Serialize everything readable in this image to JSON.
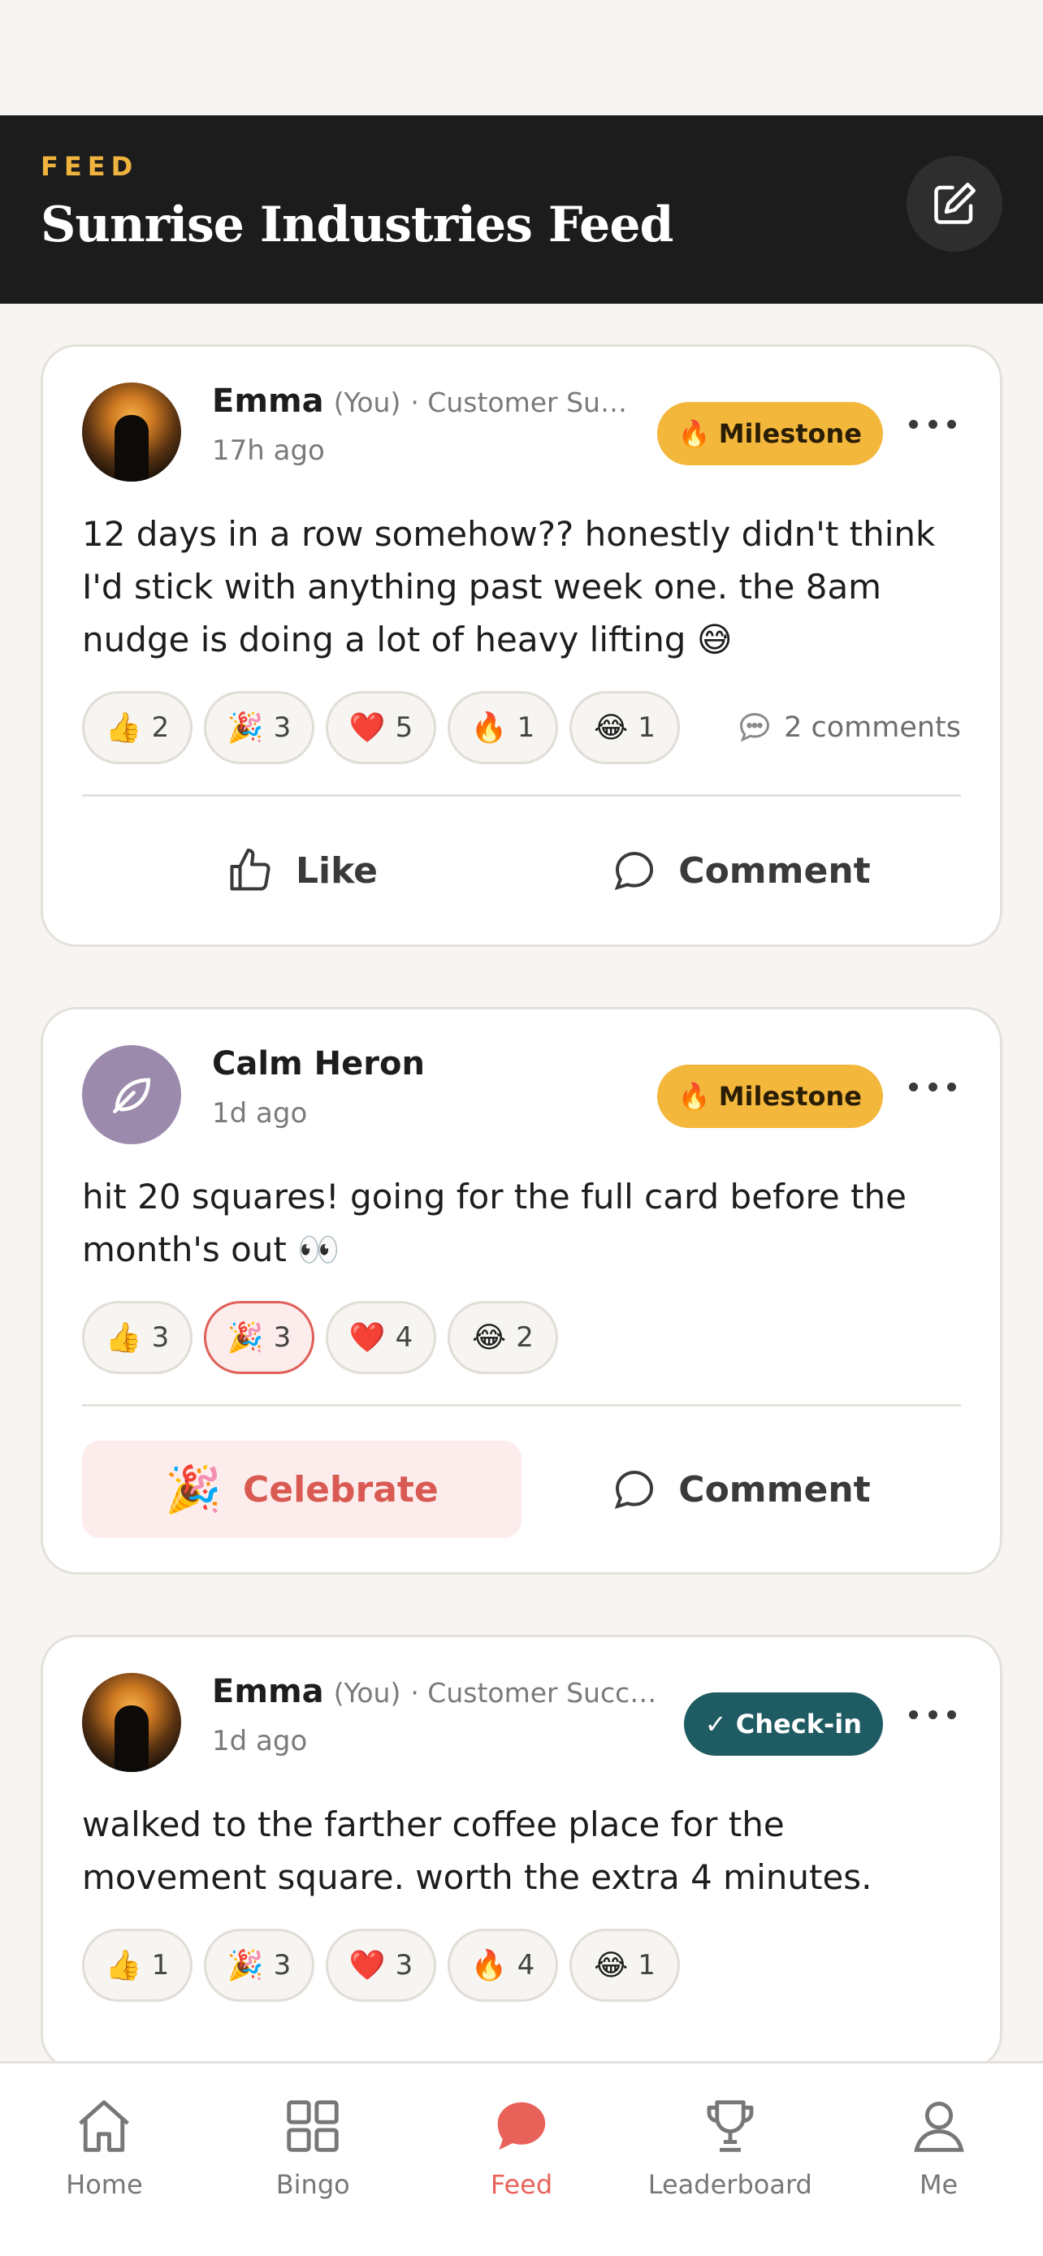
{
  "header": {
    "eyebrow": "FEED",
    "title": "Sunrise Industries Feed",
    "compose_icon": "compose-icon"
  },
  "posts": [
    {
      "author": "Emma",
      "you_tag": "(You)",
      "dept": "· Customer Succ...",
      "time": "17h ago",
      "badge": {
        "emoji": "🔥",
        "label": "Milestone",
        "type": "milestone"
      },
      "text": "12 days in a row somehow?? honestly didn't think I'd stick with anything past week one. the 8am nudge is doing a lot of heavy lifting 😅",
      "reactions": [
        {
          "emoji": "👍",
          "count": "2"
        },
        {
          "emoji": "🎉",
          "count": "3"
        },
        {
          "emoji": "❤️",
          "count": "5"
        },
        {
          "emoji": "🔥",
          "count": "1"
        },
        {
          "emoji": "😂",
          "count": "1"
        }
      ],
      "comments": "2 comments",
      "actions": {
        "primary": "Like",
        "secondary": "Comment"
      }
    },
    {
      "author": "Calm Heron",
      "time": "1d ago",
      "badge": {
        "emoji": "🔥",
        "label": "Milestone",
        "type": "milestone"
      },
      "text": "hit 20 squares! going for the full card before the month's out 👀",
      "reactions": [
        {
          "emoji": "👍",
          "count": "3"
        },
        {
          "emoji": "🎉",
          "count": "3",
          "active": true
        },
        {
          "emoji": "❤️",
          "count": "4"
        },
        {
          "emoji": "😂",
          "count": "2"
        }
      ],
      "actions": {
        "primary_emoji": "🎉",
        "primary": "Celebrate",
        "secondary": "Comment"
      }
    },
    {
      "author": "Emma",
      "you_tag": "(You)",
      "dept": "· Customer Success",
      "time": "1d ago",
      "badge": {
        "label": "✓ Check-in",
        "type": "checkin"
      },
      "text": "walked to the farther coffee place for the movement square. worth the extra 4 minutes.",
      "reactions": [
        {
          "emoji": "👍",
          "count": "1"
        },
        {
          "emoji": "🎉",
          "count": "3"
        },
        {
          "emoji": "❤️",
          "count": "3"
        },
        {
          "emoji": "🔥",
          "count": "4"
        },
        {
          "emoji": "😂",
          "count": "1"
        }
      ]
    }
  ],
  "tabbar": {
    "items": [
      {
        "label": "Home",
        "icon": "home-icon"
      },
      {
        "label": "Bingo",
        "icon": "grid-icon"
      },
      {
        "label": "Feed",
        "icon": "chat-bubble-icon",
        "active": true
      },
      {
        "label": "Leaderboard",
        "icon": "trophy-icon"
      },
      {
        "label": "Me",
        "icon": "person-icon"
      }
    ]
  },
  "colors": {
    "accent": "#e8625a",
    "milestone": "#f3b73c",
    "checkin": "#1f5b63",
    "header_bg": "#1c1c1c",
    "eyebrow": "#f0b43e"
  }
}
